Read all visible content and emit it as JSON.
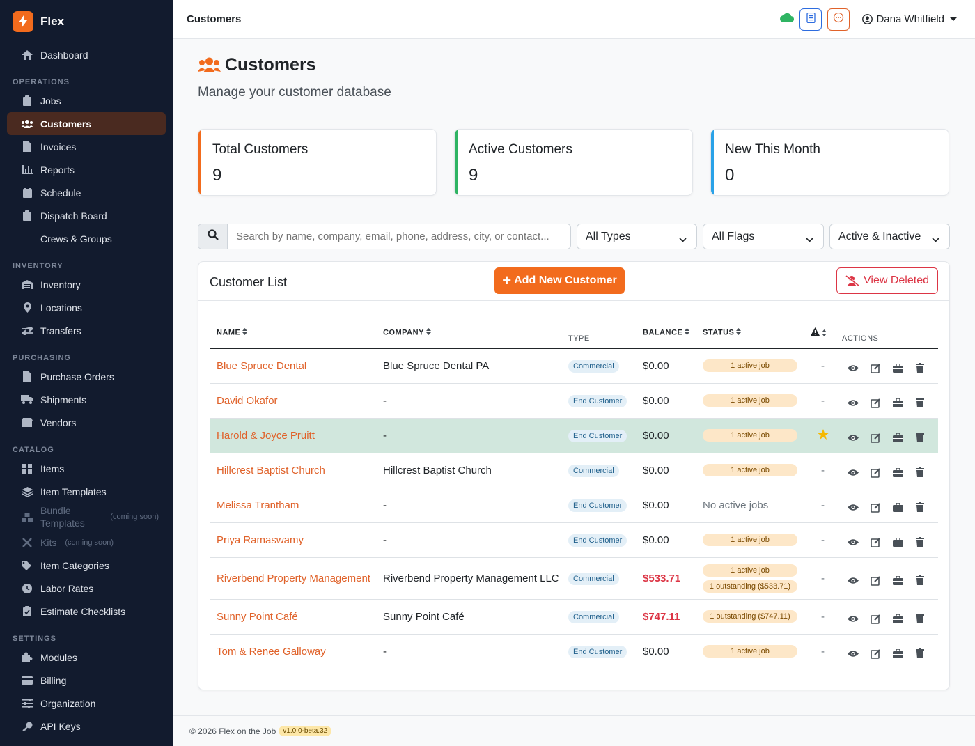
{
  "app": {
    "name": "Flex"
  },
  "sidebar": {
    "dashboard": "Dashboard",
    "sections": {
      "operations": "OPERATIONS",
      "inventory": "INVENTORY",
      "purchasing": "PURCHASING",
      "catalog": "CATALOG",
      "settings": "SETTINGS"
    },
    "operations": [
      "Jobs",
      "Customers",
      "Invoices",
      "Reports",
      "Schedule",
      "Dispatch Board",
      "Crews & Groups"
    ],
    "inventory": [
      "Inventory",
      "Locations",
      "Transfers"
    ],
    "purchasing": [
      "Purchase Orders",
      "Shipments",
      "Vendors"
    ],
    "catalog": [
      "Items",
      "Item Templates",
      "Bundle Templates",
      "Kits",
      "Item Categories",
      "Labor Rates",
      "Estimate Checklists"
    ],
    "settings": [
      "Modules",
      "Billing",
      "Organization",
      "API Keys"
    ],
    "coming_soon": "(coming soon)"
  },
  "topbar": {
    "title": "Customers",
    "user": "Dana Whitfield"
  },
  "page": {
    "title": "Customers",
    "subtitle": "Manage your customer database"
  },
  "stats": [
    {
      "label": "Total Customers",
      "value": "9"
    },
    {
      "label": "Active Customers",
      "value": "9"
    },
    {
      "label": "New This Month",
      "value": "0"
    }
  ],
  "filters": {
    "search_placeholder": "Search by name, company, email, phone, address, city, or contact...",
    "type": "All Types",
    "flags": "All Flags",
    "status": "Active & Inactive"
  },
  "list": {
    "title": "Customer List",
    "add_button": "Add New Customer",
    "deleted_button": "View Deleted",
    "columns": {
      "name": "NAME",
      "company": "COMPANY",
      "type": "TYPE",
      "balance": "BALANCE",
      "status": "STATUS",
      "actions": "ACTIONS"
    },
    "rows": [
      {
        "name": "Blue Spruce Dental",
        "company": "Blue Spruce Dental PA",
        "type": "Commercial",
        "balance": "$0.00",
        "status": [
          "1 active job"
        ],
        "flag": "-"
      },
      {
        "name": "David Okafor",
        "company": "-",
        "type": "End Customer",
        "balance": "$0.00",
        "status": [
          "1 active job"
        ],
        "flag": "-"
      },
      {
        "name": "Harold & Joyce Pruitt",
        "company": "-",
        "type": "End Customer",
        "balance": "$0.00",
        "status": [
          "1 active job"
        ],
        "flag": "star"
      },
      {
        "name": "Hillcrest Baptist Church",
        "company": "Hillcrest Baptist Church",
        "type": "Commercial",
        "balance": "$0.00",
        "status": [
          "1 active job"
        ],
        "flag": "-"
      },
      {
        "name": "Melissa Trantham",
        "company": "-",
        "type": "End Customer",
        "balance": "$0.00",
        "status_text": "No active jobs",
        "status": [],
        "flag": "-"
      },
      {
        "name": "Priya Ramaswamy",
        "company": "-",
        "type": "End Customer",
        "balance": "$0.00",
        "status": [
          "1 active job"
        ],
        "flag": "-"
      },
      {
        "name": "Riverbend Property Management",
        "company": "Riverbend Property Management LLC",
        "type": "Commercial",
        "balance": "$533.71",
        "status": [
          "1 active job",
          "1 outstanding ($533.71)"
        ],
        "flag": "-"
      },
      {
        "name": "Sunny Point Café",
        "company": "Sunny Point Café",
        "type": "Commercial",
        "balance": "$747.11",
        "status": [
          "1 outstanding ($747.11)"
        ],
        "flag": "-"
      },
      {
        "name": "Tom & Renee Galloway",
        "company": "-",
        "type": "End Customer",
        "balance": "$0.00",
        "status": [
          "1 active job"
        ],
        "flag": "-"
      }
    ]
  },
  "footer": {
    "text": "© 2026 Flex on the Job",
    "version": "v1.0.0-beta.32"
  }
}
